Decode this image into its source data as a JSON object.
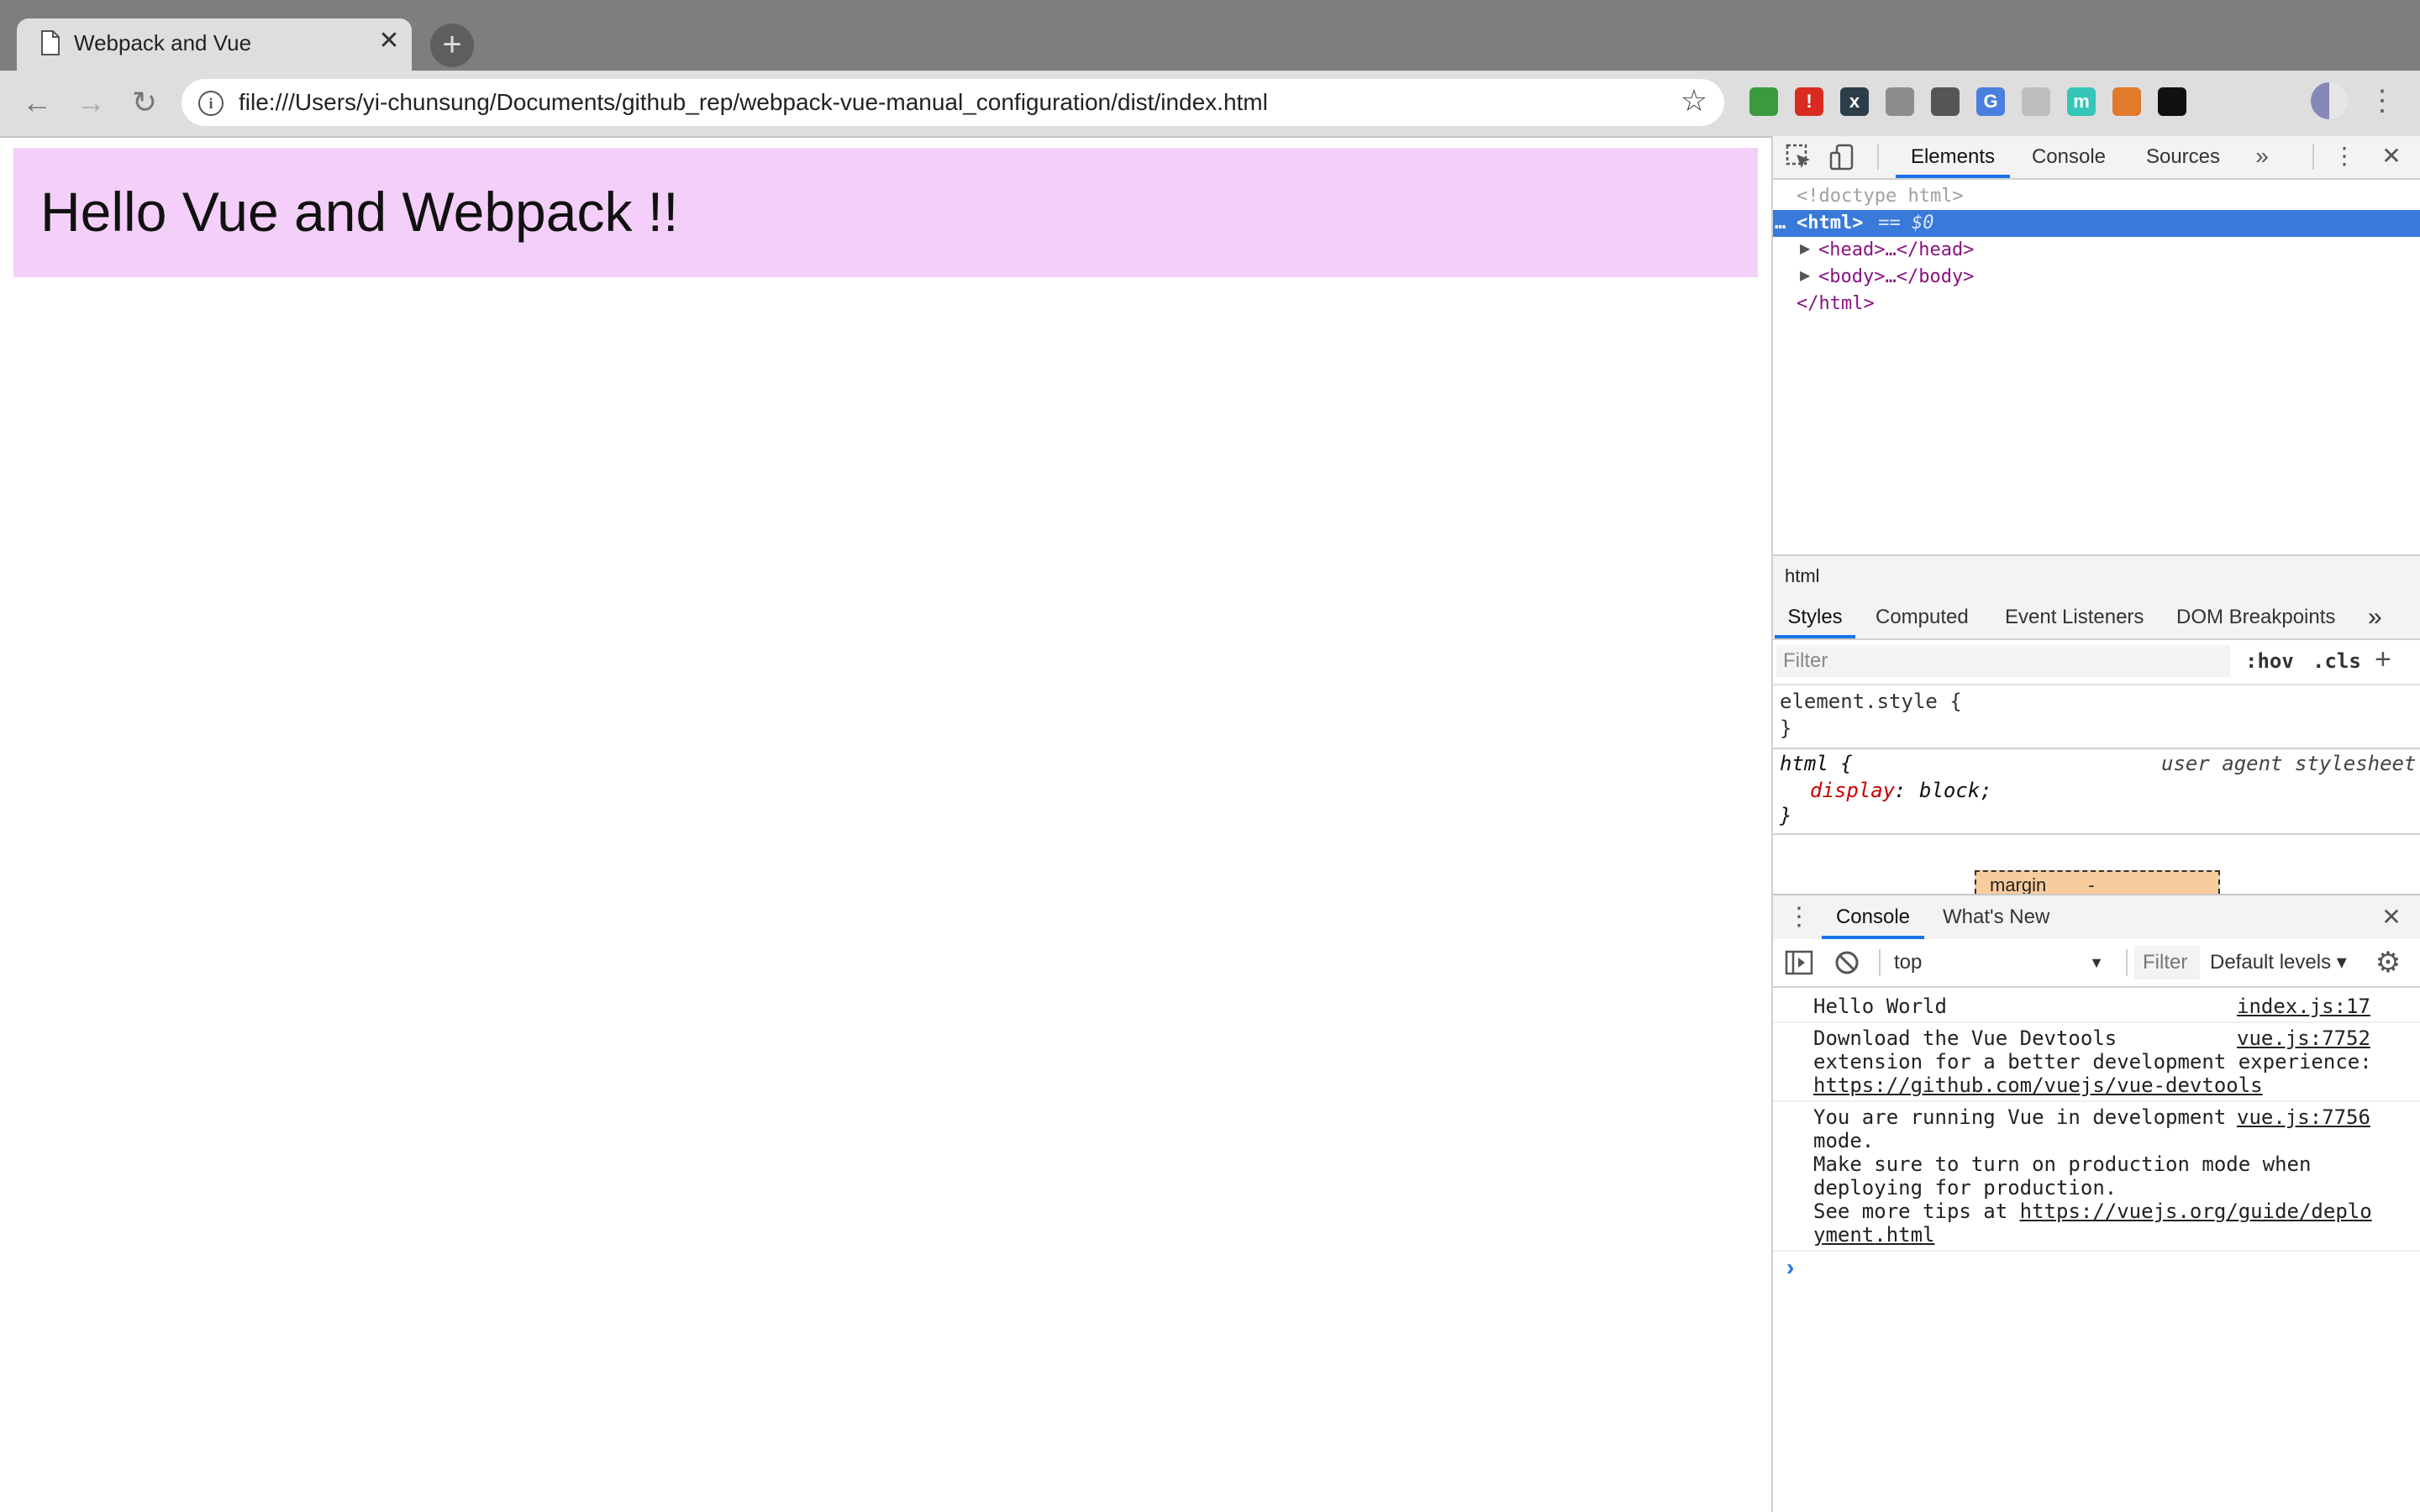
{
  "browser": {
    "tab": {
      "title": "Webpack and Vue",
      "close": "✕"
    },
    "new_tab": "+",
    "nav": {
      "back": "←",
      "forward": "→",
      "reload": "↻"
    },
    "address": {
      "info": "i",
      "url": "file:///Users/yi-chunsung/Documents/github_rep/webpack-vue-manual_configuration/dist/index.html",
      "star": "☆"
    },
    "extensions": [
      {
        "name": "green-square-extension-icon",
        "color": "#3b9a3e",
        "glyph": ""
      },
      {
        "name": "red-shield-extension-icon",
        "color": "#d92b20",
        "glyph": "!"
      },
      {
        "name": "x-box-extension-icon",
        "color": "#2c3e4a",
        "glyph": "x"
      },
      {
        "name": "grey-circle-extension-icon",
        "color": "#8d8d8d",
        "glyph": ""
      },
      {
        "name": "stamp-extension-icon",
        "color": "#555555",
        "glyph": ""
      },
      {
        "name": "google-translate-extension-icon",
        "color": "#4a7fe0",
        "glyph": "G"
      },
      {
        "name": "card-extension-icon",
        "color": "#bdbdbd",
        "glyph": ""
      },
      {
        "name": "teal-m-extension-icon",
        "color": "#36c5b9",
        "glyph": "m"
      },
      {
        "name": "fox-extension-icon",
        "color": "#e07a2c",
        "glyph": ""
      },
      {
        "name": "ghost-extension-icon",
        "color": "#111111",
        "glyph": ""
      }
    ],
    "menu": "⋮"
  },
  "page": {
    "heading": "Hello Vue and Webpack !!"
  },
  "devtools": {
    "tabs": [
      "Elements",
      "Console",
      "Sources"
    ],
    "more_tabs": "»",
    "menu": "⋮",
    "close": "✕",
    "dom": {
      "doctype": "<!doctype html>",
      "html_sel_prefix": "…",
      "html_open": "<html>",
      "html_suffix": " == $0",
      "head": "<head>…</head>",
      "body": "<body>…</body>",
      "html_close": "</html>"
    },
    "breadcrumb": "html",
    "styles_tabs": [
      "Styles",
      "Computed",
      "Event Listeners",
      "DOM Breakpoints"
    ],
    "styles_more": "»",
    "filter_placeholder": "Filter",
    "hov": ":hov",
    "cls": ".cls",
    "add_rule": "+",
    "rules": {
      "element_style_open": "element.style {",
      "element_style_close": "}",
      "html_selector": "html {",
      "html_origin": "user agent stylesheet",
      "prop_name": "display",
      "prop_value": "block;",
      "html_close": "}"
    },
    "box_model": {
      "margin_label": "margin",
      "margin_value": "-"
    },
    "drawer": {
      "tabs": [
        "Console",
        "What's New"
      ],
      "context": "top",
      "filter": "Filter",
      "levels": "Default levels ▾",
      "messages": [
        {
          "text": "Hello World",
          "source": "index.js:17"
        },
        {
          "text": "Download the Vue Devtools",
          "source": "vue.js:7752",
          "cont": "extension for a better development experience:",
          "link": "https://github.com/vuejs/vue-devtools"
        },
        {
          "text": "You are running Vue in development",
          "source": "vue.js:7756",
          "line2": "mode.",
          "line3": "Make sure to turn on production mode when",
          "line4": "deploying for production.",
          "line5_prefix": "See more tips at ",
          "link_a": "https://vuejs.org/guide/deplo",
          "link_b": "yment.html"
        }
      ],
      "prompt": "›"
    }
  }
}
